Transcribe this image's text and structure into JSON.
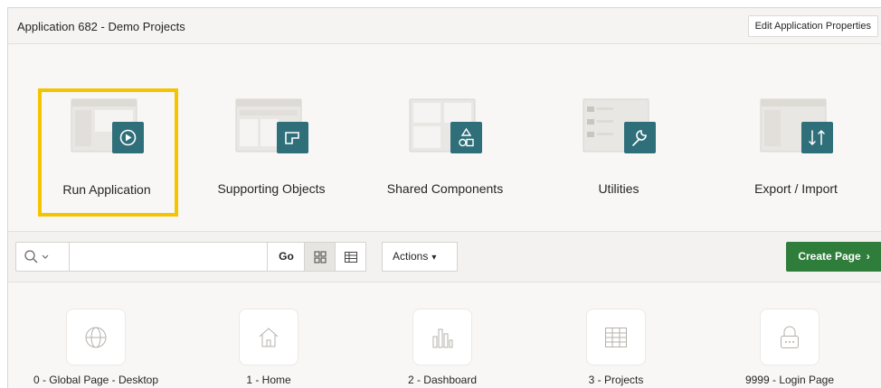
{
  "header": {
    "title": "Application 682 - Demo Projects",
    "edit_button": "Edit Application Properties"
  },
  "tiles": [
    {
      "label": "Run Application",
      "icon": "play-icon",
      "selected": true
    },
    {
      "label": "Supporting Objects",
      "icon": "supporting-objects-icon"
    },
    {
      "label": "Shared Components",
      "icon": "shapes-icon"
    },
    {
      "label": "Utilities",
      "icon": "wrench-icon"
    },
    {
      "label": "Export / Import",
      "icon": "arrows-icon"
    }
  ],
  "toolbar": {
    "search_placeholder": "",
    "go_label": "Go",
    "actions_label": "Actions",
    "create_page_label": "Create Page"
  },
  "pages": [
    {
      "label": "0 - Global Page - Desktop",
      "icon": "globe-icon"
    },
    {
      "label": "1 - Home",
      "icon": "home-icon"
    },
    {
      "label": "2 - Dashboard",
      "icon": "bar-chart-icon"
    },
    {
      "label": "3 - Projects",
      "icon": "table-icon"
    },
    {
      "label": "9999 - Login Page",
      "icon": "lock-icon"
    }
  ],
  "colors": {
    "accent": "#2f6f7a",
    "highlight": "#f5c400",
    "create_button": "#2f7d3b"
  }
}
